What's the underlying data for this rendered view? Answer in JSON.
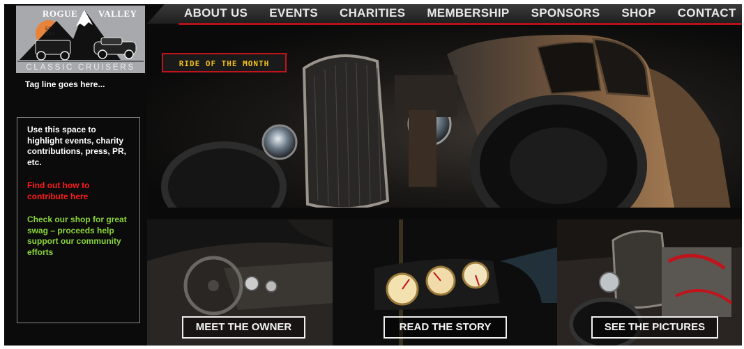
{
  "brand": {
    "logo_word_left": "ROGUE",
    "logo_word_right": "VALLEY",
    "logo_est": "EST 2014",
    "logo_tagline": "CLASSIC CRUISERS",
    "tagline": "Tag line goes here..."
  },
  "nav": {
    "items": [
      {
        "label": "ABOUT US"
      },
      {
        "label": "EVENTS"
      },
      {
        "label": "CHARITIES"
      },
      {
        "label": "MEMBERSHIP"
      },
      {
        "label": "SPONSORS"
      },
      {
        "label": "SHOP"
      },
      {
        "label": "CONTACT"
      }
    ]
  },
  "hero": {
    "badge": "RIDE OF THE MONTH"
  },
  "sidebar": {
    "highlight_text": "Use this space to highlight events, charity contributions, press, PR, etc.",
    "contribute_link": "Find out how to contribute here",
    "shop_link": "Check our shop for great swag – proceeds help support our community efforts"
  },
  "tiles": [
    {
      "label": "MEET THE OWNER"
    },
    {
      "label": "READ THE STORY"
    },
    {
      "label": "SEE THE PICTURES"
    }
  ],
  "colors": {
    "accent_red": "#b3121a",
    "badge_yellow": "#f4c21a",
    "link_red": "#ff1a1a",
    "link_green": "#8bd63a"
  }
}
